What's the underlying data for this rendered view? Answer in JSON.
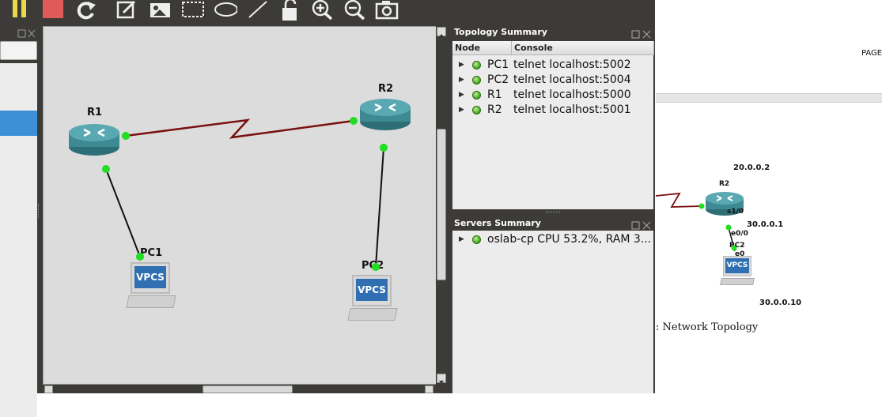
{
  "toolbar": {
    "icons": [
      "pause-icon",
      "stop-icon",
      "reload-icon",
      "note-icon",
      "image-icon",
      "rectangle-icon",
      "ellipse-icon",
      "line-icon",
      "lock-icon",
      "zoom-in-icon",
      "zoom-out-icon",
      "screenshot-icon"
    ]
  },
  "canvas": {
    "nodes": [
      {
        "label": "R1",
        "type": "router"
      },
      {
        "label": "R2",
        "type": "router"
      },
      {
        "label": "PC1",
        "type": "vpcs",
        "icon_text": "VPCS"
      },
      {
        "label": "PC2",
        "type": "vpcs",
        "icon_text": "VPCS"
      }
    ]
  },
  "topology_summary": {
    "title": "Topology Summary",
    "columns": [
      "Node",
      "Console"
    ],
    "rows": [
      {
        "node": "PC1",
        "console": "telnet localhost:5002"
      },
      {
        "node": "PC2",
        "console": "telnet localhost:5004"
      },
      {
        "node": "R1",
        "console": "telnet localhost:5000"
      },
      {
        "node": "R2",
        "console": "telnet localhost:5001"
      }
    ]
  },
  "servers_summary": {
    "title": "Servers Summary",
    "rows": [
      {
        "server": "oslab-cp CPU 53.2%, RAM 3..."
      }
    ]
  },
  "pdf": {
    "header_text": "PAGE",
    "figure": {
      "r2_label": "R2",
      "ip_r2": "20.0.0.2",
      "if_s1": "s1/0",
      "ip_s1": "30.0.0.1",
      "if_e00": "e0/0",
      "pc2_label": "PC2",
      "if_e0": "e0",
      "vpcs_text": "VPCS",
      "ip_pc2": "30.0.0.10",
      "caption": ": Network Topology"
    }
  },
  "colors": {
    "link_serial": "#7a0f0f",
    "link_ethernet": "#111111",
    "port_up": "#22dd22",
    "router_body": "#3d8a93",
    "selection_blue": "#3d8fd6"
  }
}
